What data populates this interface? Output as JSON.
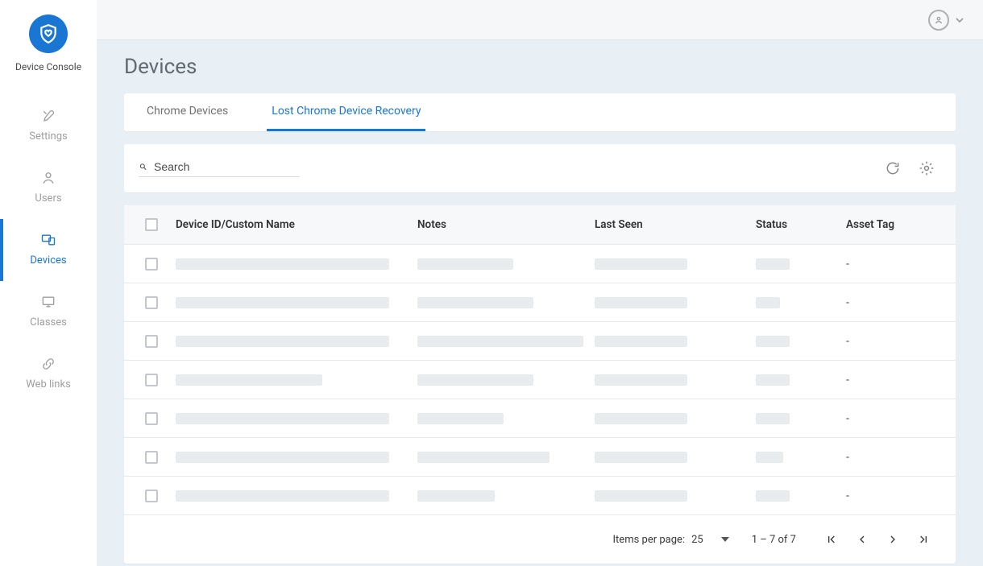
{
  "app": {
    "name": "Device Console"
  },
  "sidebar": {
    "items": [
      {
        "id": "settings",
        "label": "Settings",
        "icon": "wrench-icon",
        "active": false
      },
      {
        "id": "users",
        "label": "Users",
        "icon": "user-icon",
        "active": false
      },
      {
        "id": "devices",
        "label": "Devices",
        "icon": "devices-icon",
        "active": true
      },
      {
        "id": "classes",
        "label": "Classes",
        "icon": "monitor-icon",
        "active": false
      },
      {
        "id": "weblinks",
        "label": "Web links",
        "icon": "link-icon",
        "active": false
      }
    ]
  },
  "header": {
    "user_icon": "user-avatar"
  },
  "page": {
    "title": "Devices"
  },
  "tabs": [
    {
      "id": "chrome",
      "label": "Chrome Devices",
      "active": false
    },
    {
      "id": "lost-recovery",
      "label": "Lost Chrome Device Recovery",
      "active": true
    }
  ],
  "toolbar": {
    "search_placeholder": "Search"
  },
  "table": {
    "columns": [
      {
        "id": "device",
        "label": "Device ID/Custom Name"
      },
      {
        "id": "notes",
        "label": "Notes"
      },
      {
        "id": "lastseen",
        "label": "Last Seen"
      },
      {
        "id": "status",
        "label": "Status"
      },
      {
        "id": "asset",
        "label": "Asset Tag"
      }
    ],
    "rows": [
      {
        "asset_tag": "-",
        "widths": {
          "device": 265,
          "notes": 119,
          "lastseen": 115,
          "status": 42
        }
      },
      {
        "asset_tag": "-",
        "widths": {
          "device": 265,
          "notes": 144,
          "lastseen": 115,
          "status": 30
        }
      },
      {
        "asset_tag": "-",
        "widths": {
          "device": 265,
          "notes": 206,
          "lastseen": 115,
          "status": 42
        }
      },
      {
        "asset_tag": "-",
        "widths": {
          "device": 182,
          "notes": 144,
          "lastseen": 115,
          "status": 42
        }
      },
      {
        "asset_tag": "-",
        "widths": {
          "device": 265,
          "notes": 107,
          "lastseen": 115,
          "status": 42
        }
      },
      {
        "asset_tag": "-",
        "widths": {
          "device": 265,
          "notes": 164,
          "lastseen": 115,
          "status": 34
        }
      },
      {
        "asset_tag": "-",
        "widths": {
          "device": 265,
          "notes": 96,
          "lastseen": 115,
          "status": 42
        }
      }
    ]
  },
  "pagination": {
    "items_per_page_label": "Items per page:",
    "page_size": "25",
    "range": "1 – 7 of 7"
  }
}
